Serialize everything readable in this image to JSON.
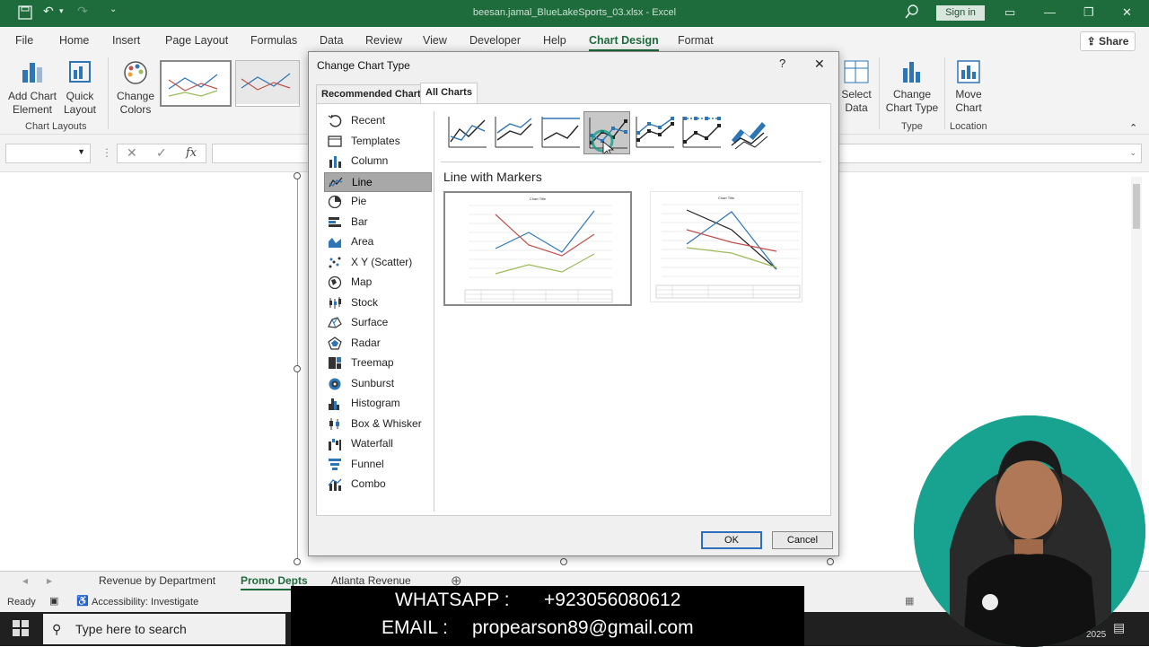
{
  "titlebar": {
    "filename": "beesan.jamal_BlueLakeSports_03.xlsx  -  Excel",
    "signin": "Sign in"
  },
  "menu": {
    "tabs": [
      "File",
      "Home",
      "Insert",
      "Page Layout",
      "Formulas",
      "Data",
      "Review",
      "View",
      "Developer",
      "Help",
      "Chart Design",
      "Format"
    ],
    "active": "Chart Design",
    "share": "Share"
  },
  "ribbon": {
    "add_chart_element": "Add Chart\nElement",
    "quick_layout": "Quick\nLayout",
    "change_colors": "Change\nColors",
    "group_chart_layouts": "Chart Layouts",
    "select_data": "Select\nData",
    "change_chart_type": "Change\nChart Type",
    "move_chart": "Move\nChart",
    "group_type": "Type",
    "group_location": "Location"
  },
  "formula_bar": {
    "fx": "fx"
  },
  "sheet_tabs": {
    "tabs": [
      "Revenue by Department",
      "Promo Depts",
      "Atlanta Revenue"
    ],
    "active": "Promo Depts"
  },
  "status": {
    "ready": "Ready",
    "accessibility": "Accessibility: Investigate"
  },
  "taskbar": {
    "search_placeholder": "Type here to search",
    "clock_fragment": "2025"
  },
  "banner": {
    "whatsapp_label": "WHATSAPP :",
    "whatsapp_value": "+923056080612",
    "email_label": "EMAIL :",
    "email_value": "propearson89@gmail.com"
  },
  "dialog": {
    "title": "Change Chart Type",
    "help": "?",
    "close": "✕",
    "tabs": [
      "Recommended Charts",
      "All Charts"
    ],
    "active_tab": "All Charts",
    "categories": [
      "Recent",
      "Templates",
      "Column",
      "Line",
      "Pie",
      "Bar",
      "Area",
      "X Y (Scatter)",
      "Map",
      "Stock",
      "Surface",
      "Radar",
      "Treemap",
      "Sunburst",
      "Histogram",
      "Box & Whisker",
      "Waterfall",
      "Funnel",
      "Combo"
    ],
    "selected_category": "Line",
    "subtype_title": "Line with Markers",
    "selected_subtype_index": 3,
    "preview_chart_title": "Chart Title",
    "ok": "OK",
    "cancel": "Cancel"
  },
  "colors": {
    "excel_green": "#1e6b3c",
    "line_blue": "#2e75b6",
    "line_red": "#c0504d",
    "line_green": "#9bbb59"
  }
}
